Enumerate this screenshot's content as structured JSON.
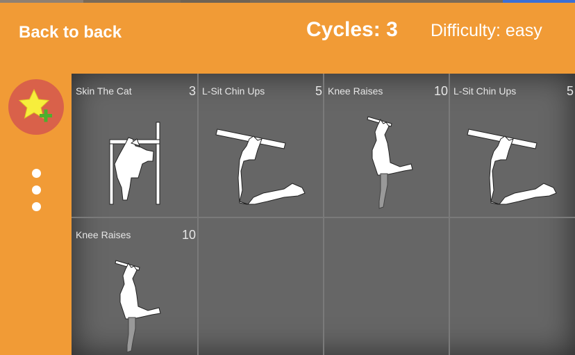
{
  "header": {
    "back_label": "Back to back",
    "cycles_label": "Cycles: 3",
    "difficulty_label": "Difficulty: easy"
  },
  "sidebar": {
    "favorite_icon": "star-plus-icon",
    "menu_icon": "vertical-dots-icon"
  },
  "exercises": [
    {
      "name": "Skin The Cat",
      "reps": "3",
      "icon": "skin-the-cat-figure"
    },
    {
      "name": "L-Sit Chin Ups",
      "reps": "5",
      "icon": "l-sit-chin-up-figure"
    },
    {
      "name": "Knee Raises",
      "reps": "10",
      "icon": "knee-raises-figure"
    },
    {
      "name": "L-Sit Chin Ups",
      "reps": "5",
      "icon": "l-sit-chin-up-figure"
    },
    {
      "name": "Knee Raises",
      "reps": "10",
      "icon": "knee-raises-figure"
    }
  ],
  "colors": {
    "background": "#F19B36",
    "favorite_button": "#D9614A",
    "grid": "#666666",
    "star": "#F7EE3C",
    "plus": "#4CAF2E"
  }
}
